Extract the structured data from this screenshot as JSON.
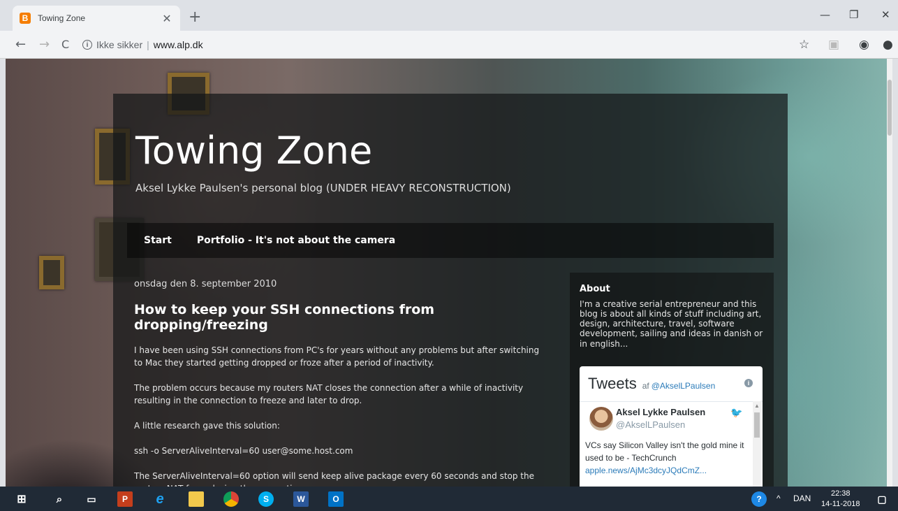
{
  "browser": {
    "tab_title": "Towing Zone",
    "tab_favicon_letter": "B",
    "close_glyph": "✕",
    "new_tab_glyph": "+",
    "minimize_glyph": "—",
    "restore_glyph": "❐",
    "window_close_glyph": "✕",
    "back_glyph": "←",
    "forward_glyph": "→",
    "reload_glyph": "C",
    "not_secure_label": "Ikke sikker",
    "url": "www.alp.dk",
    "bookmark_icon": "star-icon",
    "star_glyph": "☆",
    "profile_glyph": "◉"
  },
  "blog": {
    "title": "Towing Zone",
    "description": "Aksel Lykke Paulsen's personal blog (UNDER HEAVY RECONSTRUCTION)",
    "nav": [
      {
        "label": "Start"
      },
      {
        "label": "Portfolio - It's not about the camera"
      }
    ],
    "post": {
      "date": "onsdag den 8. september 2010",
      "title": "How to keep your SSH connections from dropping/freezing",
      "paragraphs": [
        "I have been using SSH connections from PC's for years without any problems but after switching to Mac they started getting dropped or froze after a period of inactivity.",
        "The problem occurs because my routers NAT closes the connection after a while of inactivity resulting in the connection to freeze and later to drop.",
        "A little research gave this solution:",
        "ssh -o ServerAliveInterval=60 user@some.host.com",
        "The ServerAliveInterval=60 option will send keep alive package every 60 seconds and stop the routers NAT from closing the connection."
      ]
    },
    "sidebar": {
      "about_title": "About",
      "about_text": "I'm a creative serial entrepreneur and this blog is about all kinds of stuff including art, design, architecture, travel, software development, sailing and ideas in danish or in english..."
    },
    "twitter": {
      "title": "Tweets",
      "by": "af",
      "handle": "@AkselLPaulsen",
      "info_glyph": "i",
      "tweet_name": "Aksel Lykke Paulsen",
      "tweet_user": "@AkselLPaulsen",
      "tweet_text": "VCs say Silicon Valley isn't the gold mine it used to be - TechCrunch",
      "tweet_link": "apple.news/AjMc3dcyJQdCmZ..."
    }
  },
  "taskbar": {
    "language": "DAN",
    "time": "22:38",
    "date": "14-11-2018",
    "chevron_glyph": "^"
  },
  "colors": {
    "accent_blogger": "#f57d00",
    "taskbar": "#202a36",
    "twitter_link": "#2b7bb9"
  }
}
